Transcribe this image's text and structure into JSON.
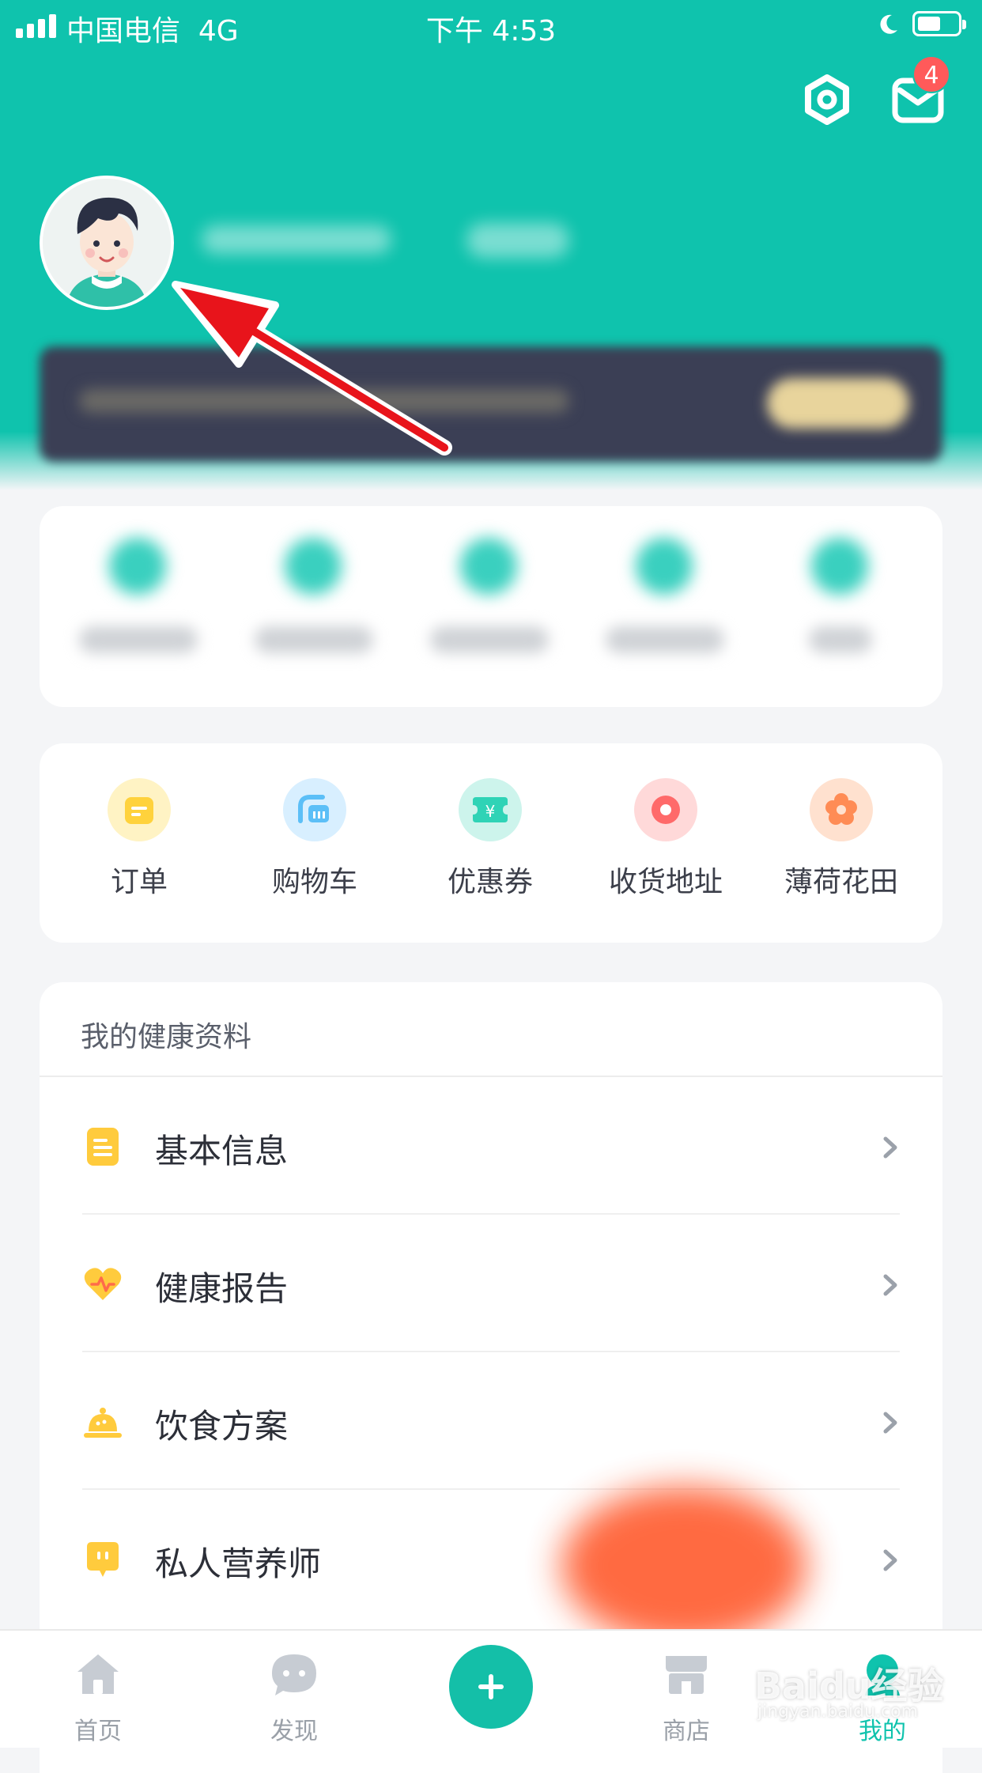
{
  "status_bar": {
    "carrier": "中国电信",
    "network": "4G",
    "time": "下午 4:53",
    "battery_level": 0.55
  },
  "header": {
    "message_badge": "4",
    "settings_icon": "hexagon-gear-icon",
    "message_icon": "envelope-icon"
  },
  "shortcuts": [
    {
      "label": "订单",
      "icon": "order-icon",
      "color": "#ffd23c"
    },
    {
      "label": "购物车",
      "icon": "cart-icon",
      "color": "#5cbff7"
    },
    {
      "label": "优惠券",
      "icon": "coupon-icon",
      "color": "#2fd3b6"
    },
    {
      "label": "收货地址",
      "icon": "location-icon",
      "color": "#ff6a6a"
    },
    {
      "label": "薄荷花田",
      "icon": "flower-icon",
      "color": "#ff8c55"
    }
  ],
  "health": {
    "title": "我的健康资料",
    "items": [
      {
        "label": "基本信息",
        "icon": "document-icon"
      },
      {
        "label": "健康报告",
        "icon": "heart-pulse-icon"
      },
      {
        "label": "饮食方案",
        "icon": "food-cloche-icon"
      },
      {
        "label": "私人营养师",
        "icon": "chat-bubble-icon"
      }
    ]
  },
  "tabbar": {
    "tabs": [
      {
        "label": "首页",
        "icon": "home-icon"
      },
      {
        "label": "发现",
        "icon": "chat-icon"
      },
      {
        "label": "商店",
        "icon": "store-icon"
      },
      {
        "label": "我的",
        "icon": "profile-icon",
        "active": true
      }
    ]
  },
  "watermark": {
    "text": "Baidu经验",
    "sub": "jingyan.baidu.com"
  },
  "colors": {
    "brand": "#0fc3ad",
    "badge": "#ff5a5a",
    "annotation_arrow": "#e8141b"
  }
}
